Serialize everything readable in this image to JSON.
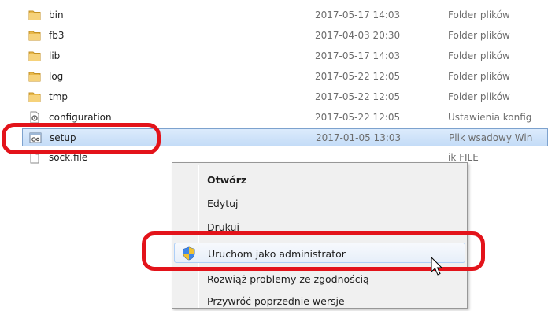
{
  "files": [
    {
      "name": "bin",
      "date": "2017-05-17 14:03",
      "type": "Folder plików",
      "icon": "folder-icon"
    },
    {
      "name": "fb3",
      "date": "2017-04-03 20:30",
      "type": "Folder plików",
      "icon": "folder-icon"
    },
    {
      "name": "lib",
      "date": "2017-05-17 14:03",
      "type": "Folder plików",
      "icon": "folder-icon"
    },
    {
      "name": "log",
      "date": "2017-05-22 12:05",
      "type": "Folder plików",
      "icon": "folder-icon"
    },
    {
      "name": "tmp",
      "date": "2017-05-22 12:05",
      "type": "Folder plików",
      "icon": "folder-icon"
    },
    {
      "name": "configuration",
      "date": "2017-05-22 12:05",
      "type": "Ustawienia konfig",
      "icon": "config-file-icon"
    },
    {
      "name": "setup",
      "date": "2017-01-05 13:03",
      "type": "Plik wsadowy Win",
      "icon": "batch-file-icon"
    },
    {
      "name": "sock.file",
      "date": "",
      "type": "ik FILE",
      "icon": "file-icon"
    }
  ],
  "context_menu": {
    "items": [
      {
        "label": "Otwórz"
      },
      {
        "label": "Edytuj"
      },
      {
        "label": "Drukuj"
      },
      {
        "label": "Uruchom jako administrator"
      },
      {
        "label": "Rozwiąż problemy ze zgodnością"
      },
      {
        "label": "Przywróć poprzednie wersje"
      }
    ]
  },
  "colors": {
    "annotation": "#e3131a",
    "folder": "#e8b84a",
    "selection": "#cce0f7"
  }
}
